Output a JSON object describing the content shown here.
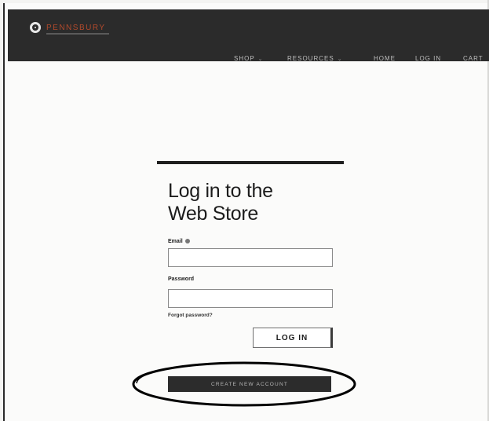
{
  "brand": {
    "name": "PENNSBURY"
  },
  "nav": {
    "items": [
      {
        "label": "SHOP",
        "has_dropdown": true
      },
      {
        "label": "RESOURCES",
        "has_dropdown": true
      },
      {
        "label": "HOME",
        "has_dropdown": false
      },
      {
        "label": "LOG IN",
        "has_dropdown": false
      },
      {
        "label": "CART",
        "has_dropdown": false
      }
    ]
  },
  "login": {
    "title_line1": "Log in to the",
    "title_line2": "Web Store",
    "email_label": "Email",
    "email_value": "",
    "password_label": "Password",
    "password_value": "",
    "forgot_link": "Forgot password?",
    "login_button": "LOG IN",
    "create_account_button": "CREATE NEW ACCOUNT"
  },
  "icons": {
    "logo": "pennsbury-logo-icon",
    "email_help": "help-icon",
    "dropdown": "chevron-down-icon"
  },
  "colors": {
    "header_bg": "#2b2b2b",
    "brand_accent": "#b24a2c",
    "annotation_ring": "#000000"
  }
}
